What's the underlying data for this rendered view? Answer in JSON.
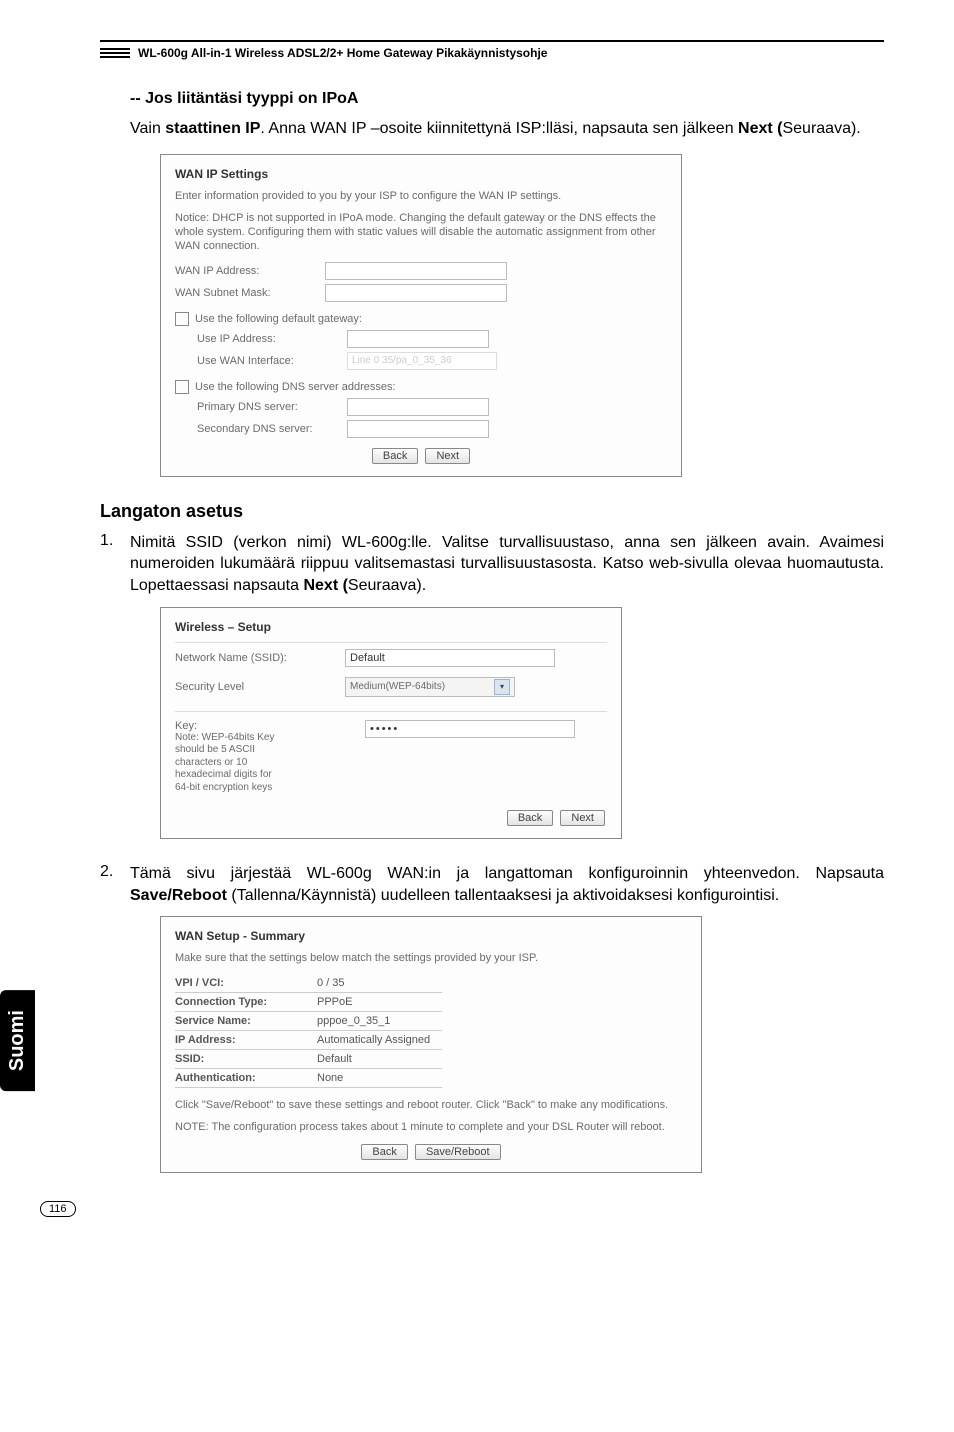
{
  "header": {
    "product_line": "WL-600g All-in-1 Wireless ADSL2/2+ Home Gateway Pikakäynnistysohje"
  },
  "sec1": {
    "heading": "-- Jos liitäntäsi tyyppi on IPoA",
    "para1a": "Vain ",
    "para1b": "staattinen IP",
    "para1c": ". Anna WAN IP –osoite kiinnitettynä ISP:lläsi, napsauta sen jälkeen ",
    "para1d": "Next (",
    "para1e": "Seuraava)."
  },
  "ss1": {
    "title": "WAN IP Settings",
    "note1": "Enter information provided to you by your ISP to configure the WAN IP settings.",
    "note2": "Notice: DHCP is not supported in IPoA mode. Changing the default gateway or the DNS effects the whole system. Configuring them with static values will disable the automatic assignment from other WAN connection.",
    "wan_ip_label": "WAN IP Address:",
    "wan_mask_label": "WAN Subnet Mask:",
    "chk_gateway": "Use the following default gateway:",
    "use_ip_label": "Use IP Address:",
    "use_wan_if_label": "Use WAN Interface:",
    "use_wan_if_ghost": "Line 0 35/pa_0_35_36",
    "chk_dns": "Use the following DNS server addresses:",
    "primary_dns_label": "Primary DNS server:",
    "secondary_dns_label": "Secondary DNS server:",
    "btn_back": "Back",
    "btn_next": "Next"
  },
  "sec2": {
    "heading": "Langaton asetus",
    "li1a": "Nimitä SSID (verkon nimi) WL-600g:lle. Valitse turvallisuustaso, anna sen jälkeen avain. Avaimesi numeroiden lukumäärä riippuu valitsemastasi turvallisuustasosta. Katso web-sivulla olevaa huomautusta. Lopettaessasi napsauta ",
    "li1b": "Next (",
    "li1c": "Seuraava)."
  },
  "ss2": {
    "title": "Wireless – Setup",
    "ssid_label": "Network Name (SSID):",
    "ssid_value": "Default",
    "sec_label": "Security Level",
    "sec_value": "Medium(WEP-64bits)",
    "key_label": "Key:",
    "key_dots": "•••••",
    "key_note": "Note: WEP-64bits Key should be 5 ASCII characters or 10 hexadecimal digits for 64-bit encryption keys",
    "btn_back": "Back",
    "btn_next": "Next"
  },
  "sec3": {
    "li2a": "Tämä sivu järjestää WL-600g WAN:in ja langattoman konfiguroinnin yhteenvedon. Napsauta ",
    "li2b": "Save/Reboot",
    "li2c": " (Tallenna/Käynnistä) uudelleen tallentaaksesi ja aktivoidaksesi konfigurointisi."
  },
  "ss3": {
    "title": "WAN Setup - Summary",
    "note": "Make sure that the settings below match the settings provided by your ISP.",
    "rows": [
      {
        "k": "VPI / VCI:",
        "v": "0 / 35"
      },
      {
        "k": "Connection Type:",
        "v": "PPPoE"
      },
      {
        "k": "Service Name:",
        "v": "pppoe_0_35_1"
      },
      {
        "k": "IP Address:",
        "v": "Automatically Assigned"
      },
      {
        "k": "SSID:",
        "v": "Default"
      },
      {
        "k": "Authentication:",
        "v": "None"
      }
    ],
    "foot1": "Click \"Save/Reboot\" to save these settings and reboot router. Click \"Back\" to make any modifications.",
    "foot2": "NOTE: The configuration process takes about 1 minute to complete and your DSL Router will reboot.",
    "btn_back": "Back",
    "btn_save": "Save/Reboot"
  },
  "side_tab": "Suomi",
  "page_number": "116"
}
